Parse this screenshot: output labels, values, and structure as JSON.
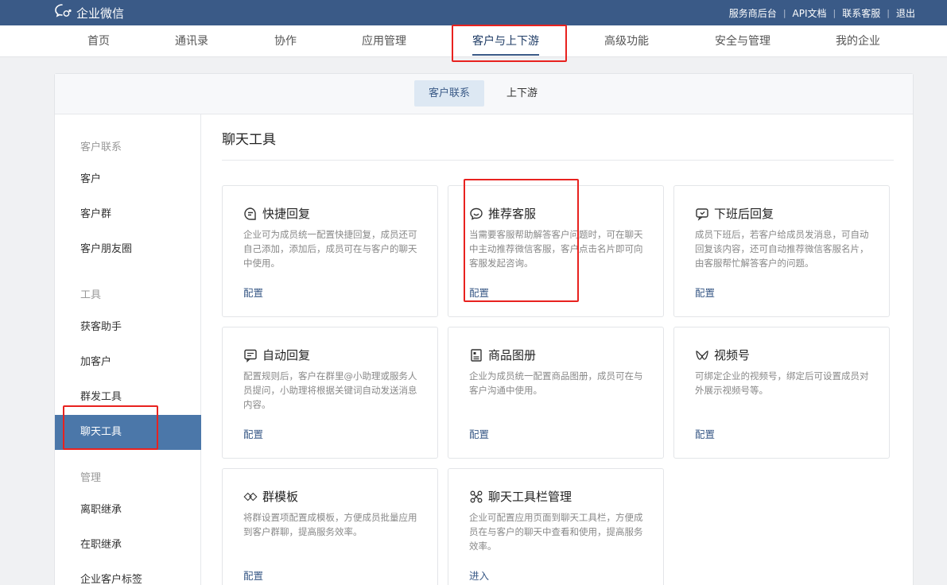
{
  "topbar": {
    "brand": "企业微信",
    "links": [
      "服务商后台",
      "API文档",
      "联系客服",
      "退出"
    ],
    "separator": "|"
  },
  "main_nav": {
    "items": [
      "首页",
      "通讯录",
      "协作",
      "应用管理",
      "客户与上下游",
      "高级功能",
      "安全与管理",
      "我的企业"
    ],
    "active": "客户与上下游"
  },
  "sub_tabs": {
    "items": [
      "客户联系",
      "上下游"
    ],
    "active": "客户联系"
  },
  "sidebar": {
    "group_customer": "客户联系",
    "customer_items": [
      "客户",
      "客户群",
      "客户朋友圈"
    ],
    "group_tools": "工具",
    "tool_items": [
      "获客助手",
      "加客户",
      "群发工具",
      "聊天工具"
    ],
    "group_manage": "管理",
    "manage_items": [
      "离职继承",
      "在职继承",
      "企业客户标签"
    ],
    "active": "聊天工具"
  },
  "content": {
    "title": "聊天工具",
    "cards": [
      {
        "icon": "quick-reply-icon",
        "title": "快捷回复",
        "desc": "企业可为成员统一配置快捷回复，成员还可自己添加，添加后，成员可在与客户的聊天中使用。",
        "action": "配置"
      },
      {
        "icon": "chat-bubble-icon",
        "title": "推荐客服",
        "desc": "当需要客服帮助解答客户问题时，可在聊天中主动推荐微信客服，客户点击名片即可向客服发起咨询。",
        "action": "配置"
      },
      {
        "icon": "after-hours-reply-icon",
        "title": "下班后回复",
        "desc": "成员下班后，若客户给成员发消息，可自动回复该内容，还可自动推荐微信客服名片，由客服帮忙解答客户的问题。",
        "action": "配置"
      },
      {
        "icon": "auto-reply-icon",
        "title": "自动回复",
        "desc": "配置规则后，客户在群里@小助理或服务人员提问，小助理将根据关键词自动发送消息内容。",
        "action": "配置"
      },
      {
        "icon": "product-album-icon",
        "title": "商品图册",
        "desc": "企业为成员统一配置商品图册，成员可在与客户沟通中使用。",
        "action": "配置"
      },
      {
        "icon": "channels-icon",
        "title": "视频号",
        "desc": "可绑定企业的视频号，绑定后可设置成员对外展示视频号等。",
        "action": "配置"
      },
      {
        "icon": "group-template-icon",
        "title": "群模板",
        "desc": "将群设置项配置成模板，方便成员批量应用到客户群聊，提高服务效率。",
        "action": "配置"
      },
      {
        "icon": "toolbar-manage-icon",
        "title": "聊天工具栏管理",
        "desc": "企业可配置应用页面到聊天工具栏，方便成员在与客户的聊天中查看和使用，提高服务效率。",
        "action": "进入"
      }
    ]
  },
  "colors": {
    "topbar": "#3a5a87",
    "accent": "#3a5a87",
    "sidebar_active": "#4b77a9",
    "highlight": "#e8221f"
  }
}
